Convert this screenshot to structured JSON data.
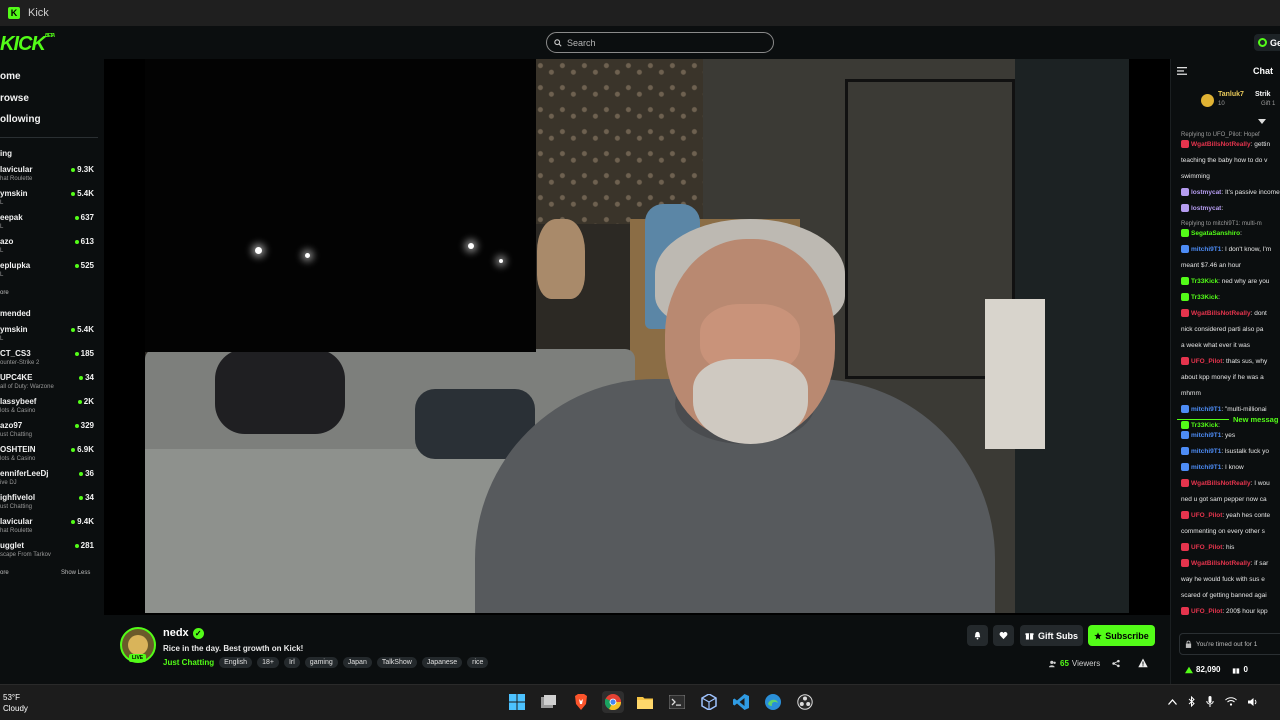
{
  "window": {
    "title": "Kick"
  },
  "nav": {
    "logo": "KICK",
    "logo_sup": "BETA",
    "search_placeholder": "Search",
    "get_label": "Ge"
  },
  "sidebar": {
    "nav_items": [
      "ome",
      "rowse",
      "ollowing"
    ],
    "following_title": "ing",
    "following": [
      {
        "name": "lavicular",
        "category": "hat Roulette",
        "viewers": "9.3K"
      },
      {
        "name": "ymskin",
        "category": "L",
        "viewers": "5.4K"
      },
      {
        "name": "eepak",
        "category": "L",
        "viewers": "637"
      },
      {
        "name": "azo",
        "category": "L",
        "viewers": "613"
      },
      {
        "name": "eplupka",
        "category": "L",
        "viewers": "525"
      }
    ],
    "following_more": "ore",
    "recommended_title": "mended",
    "recommended": [
      {
        "name": "ymskin",
        "category": "L",
        "viewers": "5.4K"
      },
      {
        "name": "CT_CS3",
        "category": "ounter-Strike 2",
        "viewers": "185"
      },
      {
        "name": "UPC4KE",
        "category": "all of Duty: Warzone",
        "viewers": "34"
      },
      {
        "name": "lassybeef",
        "category": "lots & Casino",
        "viewers": "2K"
      },
      {
        "name": "azo97",
        "category": "ust Chatting",
        "viewers": "329"
      },
      {
        "name": "OSHTEIN",
        "category": "lots & Casino",
        "viewers": "6.9K"
      },
      {
        "name": "enniferLeeDj",
        "category": "ive DJ",
        "viewers": "36"
      },
      {
        "name": "ighfivelol",
        "category": "ust Chatting",
        "viewers": "34"
      },
      {
        "name": "lavicular",
        "category": "hat Roulette",
        "viewers": "9.4K"
      },
      {
        "name": "ugglet",
        "category": "scape From Tarkov",
        "viewers": "281"
      }
    ],
    "recommended_more": "ore",
    "show_less": "Show Less"
  },
  "stream": {
    "streamer": "nedx",
    "live_badge": "LIVE",
    "title": "Rice in the day. Best growth on Kick!",
    "category": "Just Chatting",
    "tags": [
      "English",
      "18+",
      "Irl",
      "gaming",
      "Japan",
      "TalkShow",
      "Japanese",
      "rice"
    ],
    "viewers_count": "65",
    "viewers_label": "Viewers",
    "gift_label": "Gift Subs",
    "subscribe_label": "Subscribe"
  },
  "chat": {
    "title": "Chat",
    "pinned": {
      "user": "Tanluk7",
      "amount": "10",
      "user2": "Strik",
      "sub2": "Gift 1"
    },
    "messages": [
      {
        "reply": "Replying to UFO_Pilot: Hopef",
        "user": "WgatBillsNotReally",
        "color": "#e5344d",
        "text": ": gettin"
      },
      {
        "user": "",
        "color": "#e6e6e6",
        "text": "teaching the baby how to do v"
      },
      {
        "user": "",
        "color": "#e6e6e6",
        "text": "swimming"
      },
      {
        "user": "lostmycat",
        "color": "#b59cf0",
        "text": ": It's passive income"
      },
      {
        "user": "lostmycat",
        "color": "#b59cf0",
        "text": ":"
      },
      {
        "reply": "Replying to mitchi9T1: multi-m",
        "user": "SegataSanshiro",
        "color": "#53fc18",
        "text": ":"
      },
      {
        "user": "mitchi9T1",
        "color": "#4d8cf5",
        "text": ": I don't know, I'm"
      },
      {
        "user": "",
        "color": "#e6e6e6",
        "text": "meant $7.46 an hour"
      },
      {
        "user": "Tr33Kick",
        "color": "#53fc18",
        "text": ": ned why are you"
      },
      {
        "user": "Tr33Kick",
        "color": "#53fc18",
        "text": ":"
      },
      {
        "user": "WgatBillsNotReally",
        "color": "#e5344d",
        "text": ": dont"
      },
      {
        "user": "",
        "color": "#e6e6e6",
        "text": "nick considered parti also pa"
      },
      {
        "user": "",
        "color": "#e6e6e6",
        "text": "a week what ever it was"
      },
      {
        "user": "UFO_Pilot",
        "color": "#e5344d",
        "text": ": thats sus, why"
      },
      {
        "user": "",
        "color": "#e6e6e6",
        "text": "about kpp money if he was a"
      },
      {
        "user": "",
        "color": "#e6e6e6",
        "text": "mhmm"
      },
      {
        "user": "mitchi9T1",
        "color": "#4d8cf5",
        "text": ": \"multi-millionai"
      },
      {
        "user": "Tr33Kick",
        "color": "#53fc18",
        "text": ":"
      }
    ],
    "new_messages": "New messag",
    "messages2": [
      {
        "user": "mitchi9T1",
        "color": "#4d8cf5",
        "text": ": yes"
      },
      {
        "user": "mitchi9T1",
        "color": "#4d8cf5",
        "text": ": lsustalk fuck yo"
      },
      {
        "user": "mitchi9T1",
        "color": "#4d8cf5",
        "text": ": I know"
      },
      {
        "user": "WgatBillsNotReally",
        "color": "#e5344d",
        "text": ": I wou"
      },
      {
        "user": "",
        "color": "#e6e6e6",
        "text": "ned u got sam pepper now ca"
      },
      {
        "user": "UFO_Pilot",
        "color": "#e5344d",
        "text": ": yeah hes conte"
      },
      {
        "user": "",
        "color": "#e6e6e6",
        "text": "commenting on every other s"
      },
      {
        "user": "UFO_Pilot",
        "color": "#e5344d",
        "text": ": his"
      },
      {
        "user": "WgatBillsNotReally",
        "color": "#e5344d",
        "text": ": if sar"
      },
      {
        "user": "",
        "color": "#e6e6e6",
        "text": "way he would fuck with sus e"
      },
      {
        "user": "",
        "color": "#e6e6e6",
        "text": "scared of getting banned agai"
      },
      {
        "user": "UFO_Pilot",
        "color": "#e5344d",
        "text": ": 200$ hour kpp"
      }
    ],
    "timeout_text": "You're timed out for 1",
    "points": "82,090",
    "other_count": "0"
  },
  "taskbar": {
    "temp": "53°F",
    "weather": "Cloudy",
    "apps": [
      "windows-start",
      "task-view",
      "brave",
      "chrome",
      "file-explorer",
      "terminal",
      "virtualbox",
      "vscode",
      "edge",
      "obs"
    ]
  },
  "colors": {
    "accent": "#53fc18",
    "bg": "#0b0e0f"
  }
}
